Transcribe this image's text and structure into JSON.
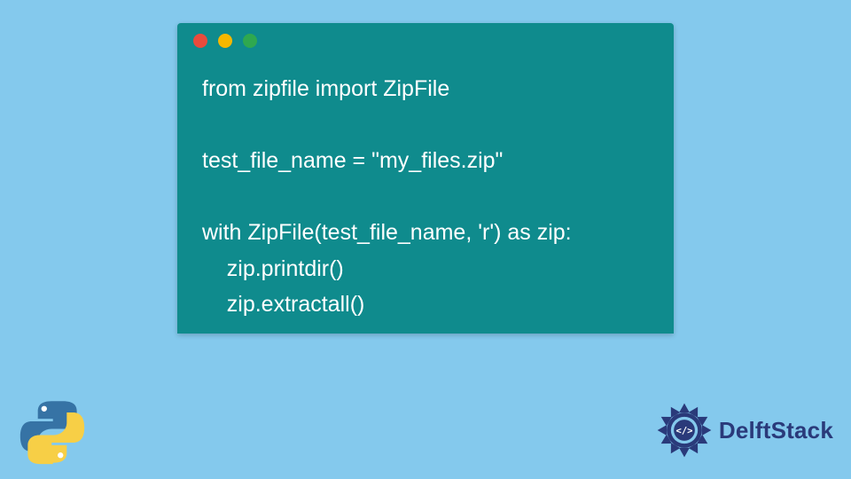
{
  "code_block": {
    "lines": [
      "from zipfile import ZipFile",
      "",
      "test_file_name = \"my_files.zip\"",
      "",
      "with ZipFile(test_file_name, 'r') as zip:",
      "    zip.printdir()",
      "    zip.extractall()"
    ]
  },
  "window_controls": {
    "red": "#e94b3c",
    "yellow": "#f5b700",
    "green": "#2fa84f"
  },
  "icons": {
    "python": "python-logo",
    "brand_gear": "delftstack-gear"
  },
  "brand": {
    "name": "DelftStack"
  },
  "colors": {
    "page_bg": "#84c9ed",
    "card_bg": "#0f8b8d",
    "code_text": "#ffffff",
    "brand_text": "#2a3a7a"
  }
}
